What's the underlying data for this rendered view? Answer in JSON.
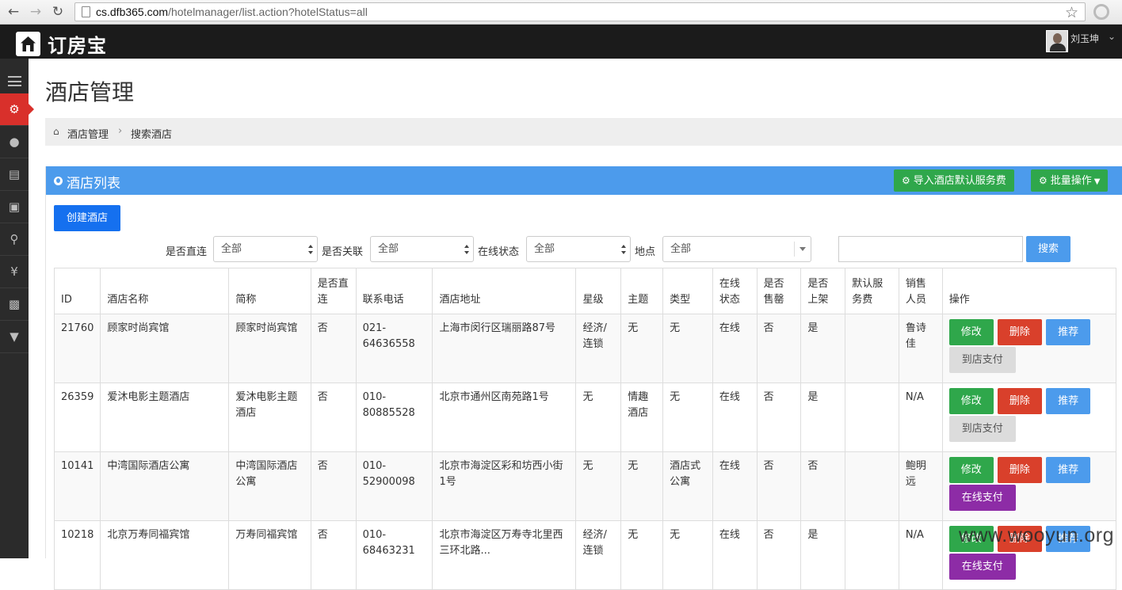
{
  "browser": {
    "url_host": "cs.dfb365.com",
    "url_path": "/hotelmanager/list.action?hotelStatus=all"
  },
  "header": {
    "logo_text": "订房宝",
    "user_name": "刘玉坤"
  },
  "sidebar": {
    "items": [
      {
        "icon": "menu-icon"
      },
      {
        "icon": "gears-icon",
        "active": true
      },
      {
        "icon": "user-icon"
      },
      {
        "icon": "document-icon"
      },
      {
        "icon": "gift-icon"
      },
      {
        "icon": "map-marker-icon"
      },
      {
        "icon": "yen-icon"
      },
      {
        "icon": "bar-chart-icon"
      },
      {
        "icon": "filter-icon"
      }
    ]
  },
  "page": {
    "title": "酒店管理",
    "breadcrumb": [
      "酒店管理",
      "搜索酒店"
    ]
  },
  "panel": {
    "title": "酒店列表",
    "import_button": "导入酒店默认服务费",
    "batch_button": "批量操作",
    "create_button": "创建酒店",
    "search_button": "搜索"
  },
  "filters": [
    {
      "label": "是否直连",
      "value": "全部"
    },
    {
      "label": "是否关联",
      "value": "全部"
    },
    {
      "label": "在线状态",
      "value": "全部"
    },
    {
      "label": "地点",
      "value": "全部"
    }
  ],
  "table": {
    "columns": [
      "ID",
      "酒店名称",
      "简称",
      "是否直连",
      "联系电话",
      "酒店地址",
      "星级",
      "主题",
      "类型",
      "在线状态",
      "是否售罄",
      "是否上架",
      "默认服务费",
      "销售人员",
      "操作"
    ],
    "rows": [
      {
        "id": "21760",
        "name": "顾家时尚宾馆",
        "short": "顾家时尚宾馆",
        "direct": "否",
        "phone": "021-64636558",
        "address": "上海市闵行区瑞丽路87号",
        "star": "经济/连锁",
        "theme": "无",
        "type": "无",
        "online": "在线",
        "soldout": "否",
        "listed": "是",
        "fee": "",
        "sales": "鲁诗佳",
        "pay": "到店支付",
        "pay_style": "gray"
      },
      {
        "id": "26359",
        "name": "爱沐电影主题酒店",
        "short": "爱沐电影主题酒店",
        "direct": "否",
        "phone": "010-80885528",
        "address": "北京市通州区南苑路1号",
        "star": "无",
        "theme": "情趣酒店",
        "type": "无",
        "online": "在线",
        "soldout": "否",
        "listed": "是",
        "fee": "",
        "sales": "N/A",
        "pay": "到店支付",
        "pay_style": "gray"
      },
      {
        "id": "10141",
        "name": "中湾国际酒店公寓",
        "short": "中湾国际酒店公寓",
        "direct": "否",
        "phone": "010-52900098",
        "address": "北京市海淀区彩和坊西小街1号",
        "star": "无",
        "theme": "无",
        "type": "酒店式公寓",
        "online": "在线",
        "soldout": "否",
        "listed": "否",
        "fee": "",
        "sales": "鲍明远",
        "pay": "在线支付",
        "pay_style": "purple"
      },
      {
        "id": "10218",
        "name": "北京万寿同福宾馆",
        "short": "万寿同福宾馆",
        "direct": "否",
        "phone": "010-68463231",
        "address": "北京市海淀区万寿寺北里西三环北路...",
        "star": "经济/连锁",
        "theme": "无",
        "type": "无",
        "online": "在线",
        "soldout": "否",
        "listed": "是",
        "fee": "",
        "sales": "N/A",
        "pay": "在线支付",
        "pay_style": "purple"
      }
    ],
    "op_labels": {
      "edit": "修改",
      "delete": "删除",
      "recommend": "推荐"
    }
  },
  "watermark": "www.wooyun.org",
  "colors": {
    "primary": "#4c9bec",
    "green": "#2fa74b",
    "red": "#d9402b",
    "purple": "#8d2ca6",
    "create": "#1570ef"
  }
}
